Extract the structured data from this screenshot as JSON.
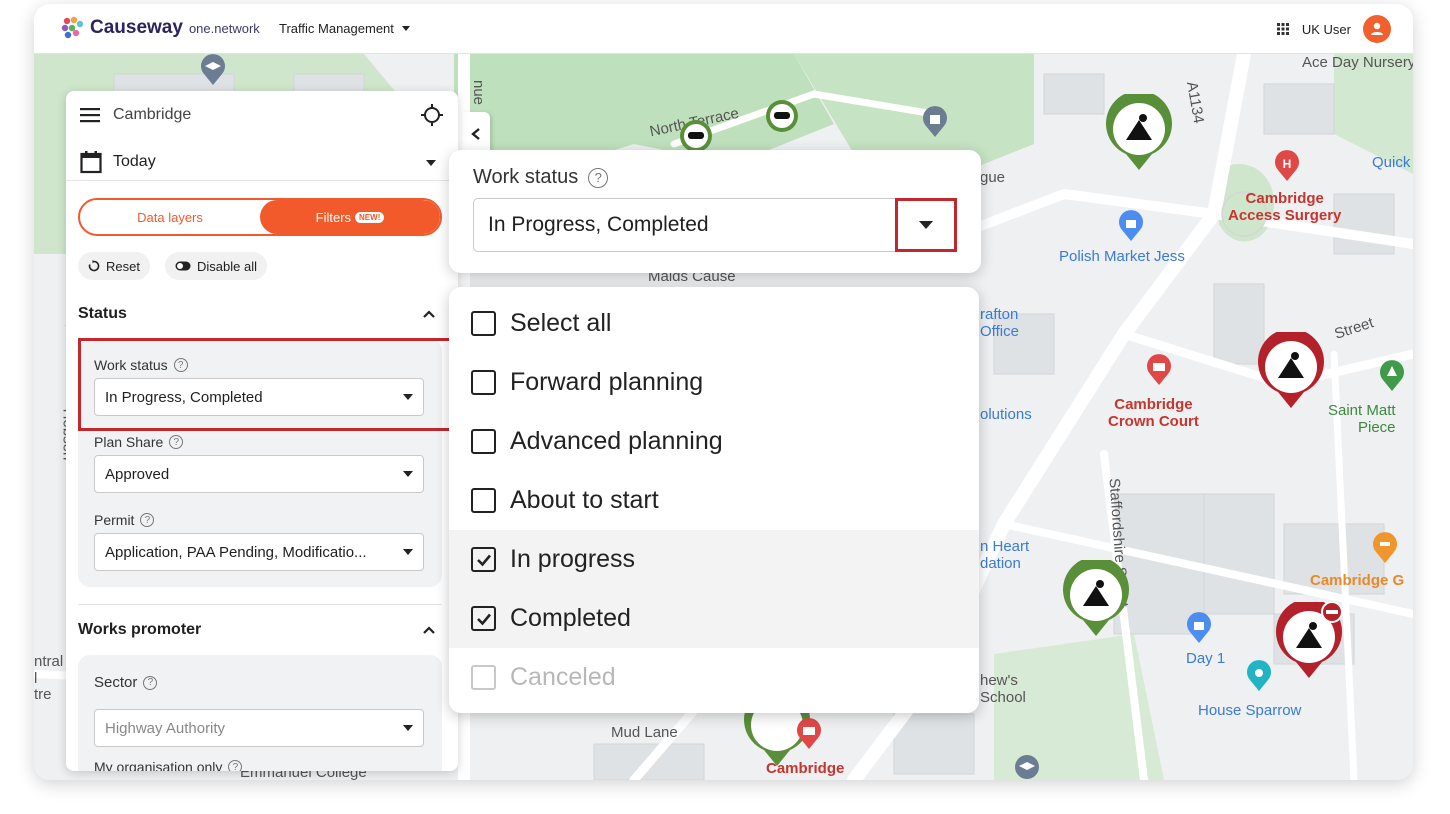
{
  "header": {
    "brand": "Causeway",
    "brand_sub": "one.network",
    "app_menu": "Traffic Management",
    "user_name": "UK User"
  },
  "map": {
    "labels": [
      {
        "id": "ace-day",
        "text": "Ace Day Nursery"
      },
      {
        "id": "north-terrace",
        "text": "North Terrace"
      },
      {
        "id": "a1134",
        "text": "A1134"
      },
      {
        "id": "cambridge-access",
        "text": "Cambridge\nAccess Surgery"
      },
      {
        "id": "quick",
        "text": "Quick"
      },
      {
        "id": "polish-market",
        "text": "Polish Market Jess"
      },
      {
        "id": "gue",
        "text": "gue"
      },
      {
        "id": "maids",
        "text": "Maids Cause"
      },
      {
        "id": "rafton",
        "text": "rafton\nOffice"
      },
      {
        "id": "street",
        "text": "Street"
      },
      {
        "id": "olutions",
        "text": "olutions"
      },
      {
        "id": "crown-court",
        "text": "Cambridge\nCrown Court"
      },
      {
        "id": "saint-matt",
        "text": "Saint Matt\nPiece"
      },
      {
        "id": "staffordshire",
        "text": "Staffordshire Street"
      },
      {
        "id": "heart",
        "text": "n Heart\ndation"
      },
      {
        "id": "cambridge-g",
        "text": "Cambridge G"
      },
      {
        "id": "day1",
        "text": "Day 1"
      },
      {
        "id": "hews",
        "text": "hew's\nSchool"
      },
      {
        "id": "house-sparrow",
        "text": "House Sparrow"
      },
      {
        "id": "mud-lane",
        "text": "Mud Lane"
      },
      {
        "id": "cambridge-bottom",
        "text": "Cambridge"
      },
      {
        "id": "emmanuel",
        "text": "Emmanuel College"
      },
      {
        "id": "ntral",
        "text": "ntral\nl\ntre"
      },
      {
        "id": "nue",
        "text": "nue"
      },
      {
        "id": "hobson",
        "text": "Hobson"
      }
    ]
  },
  "panel": {
    "location": "Cambridge",
    "date": "Today",
    "tabs": {
      "data_layers": "Data layers",
      "filters": "Filters",
      "filters_badge": "NEW!"
    },
    "reset": "Reset",
    "disable_all": "Disable all",
    "status_section": "Status",
    "fields": {
      "work_status": {
        "label": "Work status",
        "value": "In Progress, Completed"
      },
      "plan_share": {
        "label": "Plan Share",
        "value": "Approved"
      },
      "permit": {
        "label": "Permit",
        "value": "Application, PAA Pending, Modificatio..."
      }
    },
    "works_promoter_section": "Works promoter",
    "sector": {
      "label": "Sector",
      "placeholder": "Highway Authority"
    },
    "my_org_label": "My organisation only"
  },
  "zoom": {
    "label": "Work status",
    "value": "In Progress, Completed"
  },
  "dropdown": {
    "options": [
      {
        "label": "Select all",
        "checked": false,
        "disabled": false
      },
      {
        "label": "Forward planning",
        "checked": false,
        "disabled": false
      },
      {
        "label": "Advanced planning",
        "checked": false,
        "disabled": false
      },
      {
        "label": "About to start",
        "checked": false,
        "disabled": false
      },
      {
        "label": "In progress",
        "checked": true,
        "disabled": false
      },
      {
        "label": "Completed",
        "checked": true,
        "disabled": false
      },
      {
        "label": "Canceled",
        "checked": false,
        "disabled": true
      }
    ]
  },
  "colors": {
    "accent": "#f25a2c",
    "highlight": "#c1272d",
    "pin_green": "#5a8f3a",
    "pin_red": "#b3222a"
  }
}
